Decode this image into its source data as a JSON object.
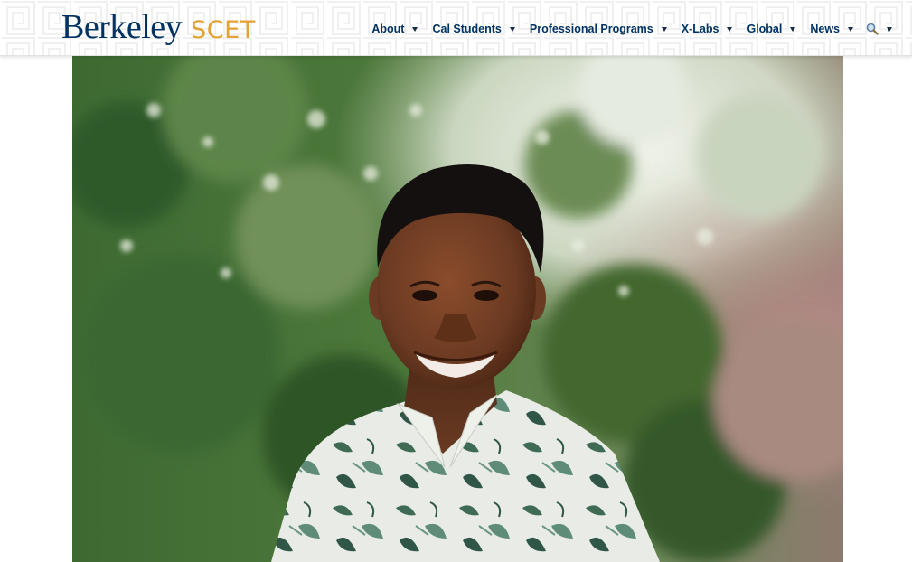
{
  "brand": {
    "name": "Berkeley",
    "suffix": "SCET",
    "name_color": "#003262",
    "suffix_color": "#e3a234"
  },
  "nav": {
    "items": [
      {
        "label": "About"
      },
      {
        "label": "Cal Students"
      },
      {
        "label": "Professional Programs"
      },
      {
        "label": "X-Labs"
      },
      {
        "label": "Global"
      },
      {
        "label": "News"
      }
    ],
    "search_icon": "magnifier-icon",
    "caret_icon": "caret-down-icon",
    "text_color": "#003262"
  },
  "hero": {
    "image": "portrait-photo"
  }
}
